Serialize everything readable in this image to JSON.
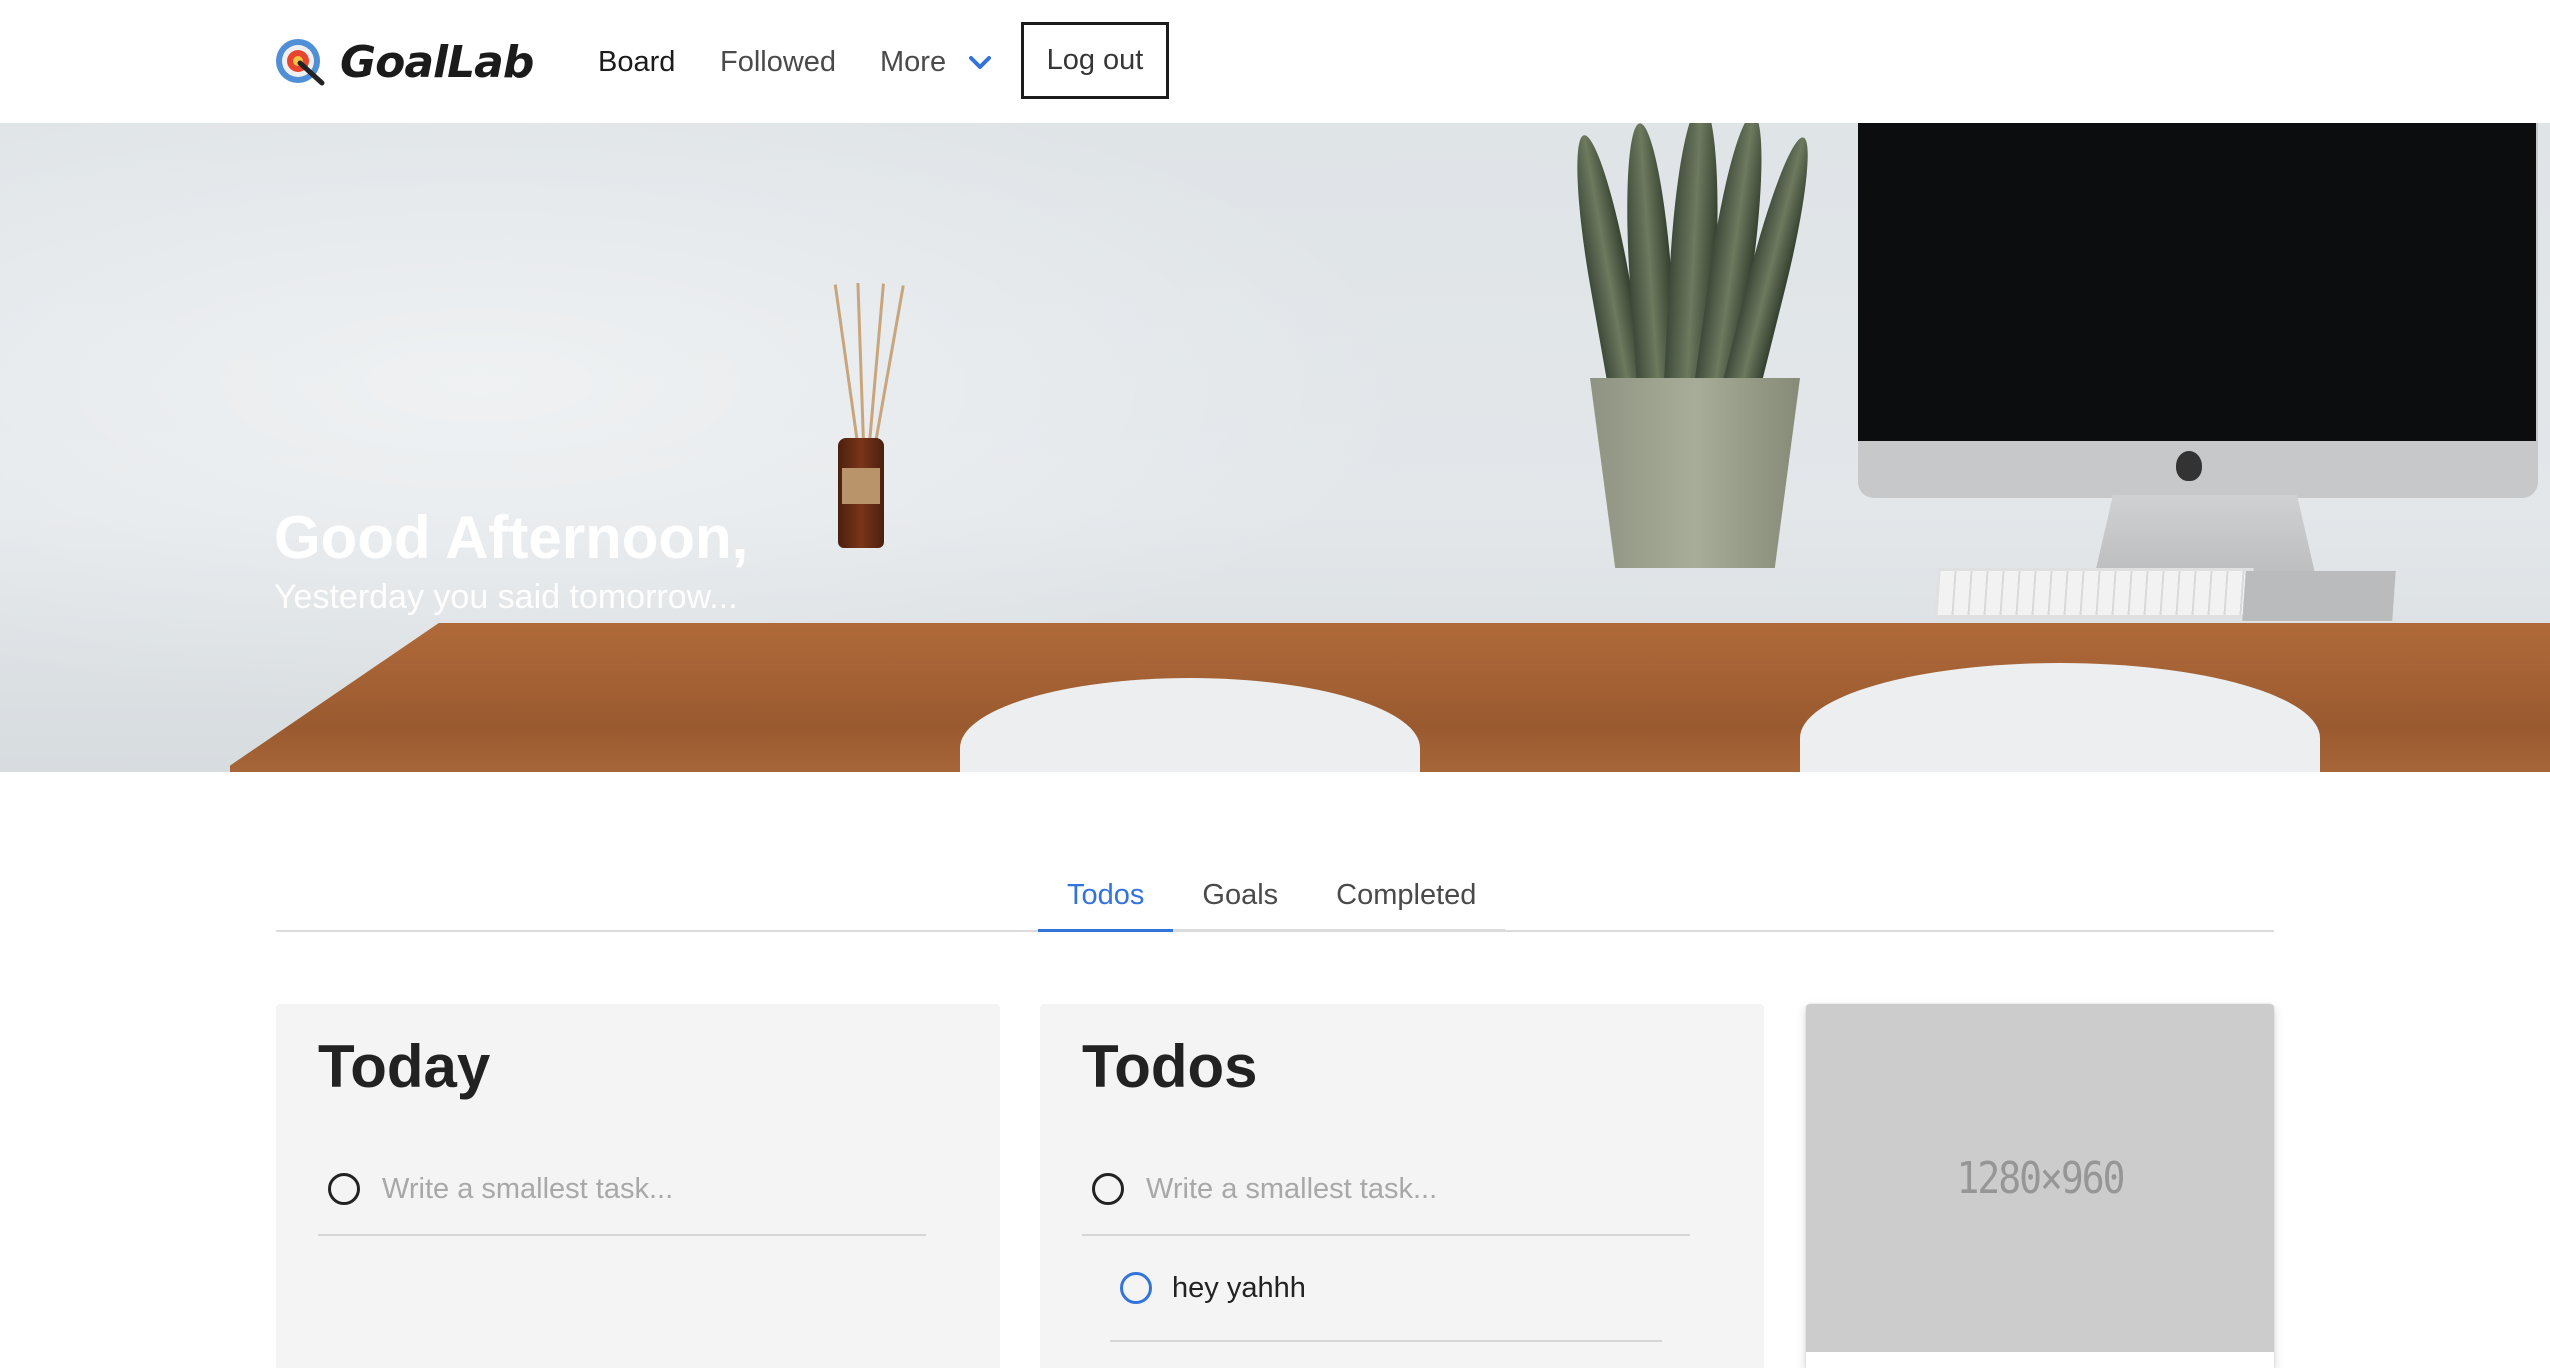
{
  "brand": {
    "name": "GoalLab",
    "logo_icon": "target-icon"
  },
  "nav": {
    "items": [
      {
        "label": "Board",
        "active": true
      },
      {
        "label": "Followed",
        "active": false
      },
      {
        "label": "More",
        "active": false,
        "icon": "chevron-down-icon"
      }
    ],
    "logout_label": "Log out"
  },
  "hero": {
    "title": "Good Afternoon,",
    "subtitle": "Yesterday you said tomorrow..."
  },
  "tabs": [
    {
      "label": "Todos",
      "active": true
    },
    {
      "label": "Goals",
      "active": false
    },
    {
      "label": "Completed",
      "active": false
    }
  ],
  "cards": {
    "today": {
      "title": "Today",
      "input_placeholder": "Write a smallest task..."
    },
    "todos": {
      "title": "Todos",
      "input_placeholder": "Write a smallest task...",
      "items": [
        {
          "text": "hey yahhh"
        }
      ]
    },
    "image": {
      "placeholder_text": "1280×960"
    }
  },
  "colors": {
    "accent": "#3273dc",
    "card_bg": "#f4f4f4",
    "placeholder_bg": "#cccccc"
  }
}
